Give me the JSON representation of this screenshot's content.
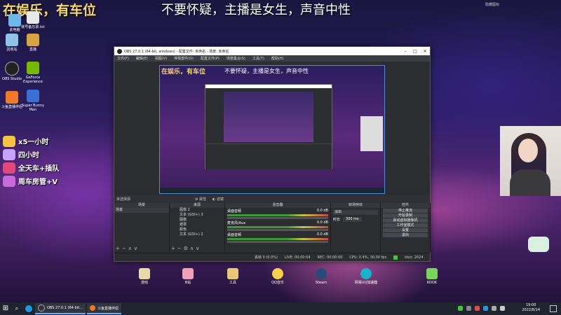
{
  "overlay": {
    "title_left": "在娱乐，有车位",
    "title_center": "不要怀疑，主播是女生，声音中性",
    "top_right_label": "隐藏图标"
  },
  "desktop_icons": [
    {
      "label": "此电脑",
      "color": "#6fb7e8"
    },
    {
      "label": "账号备忘录.txt",
      "color": "#e8e8e8"
    },
    {
      "label": "回收站",
      "color": "#8fc3e8"
    },
    {
      "label": "直播",
      "color": "#d9a441"
    },
    {
      "label": "OBS Studio",
      "color": "#222222"
    },
    {
      "label": "GeForce Experience",
      "color": "#76b900"
    },
    {
      "label": "斗鱼直播伴侣",
      "color": "#f07a2a"
    },
    {
      "label": "Super Bunny Man",
      "color": "#3a6fd8"
    }
  ],
  "badges": [
    {
      "label": "x5一小时",
      "color": "#f5c542"
    },
    {
      "label": "四小时",
      "color": "#c7a3ff"
    },
    {
      "label": "全天车+插队",
      "color": "#e04a7a"
    },
    {
      "label": "周车房管+V",
      "color": "#c86ad8"
    }
  ],
  "obs": {
    "title": "OBS 27.0.1 (64-bit, windows) - 配置文件: 未命名 - 场景: 未命名",
    "menu": [
      "文件(F)",
      "编辑(E)",
      "视图(V)",
      "停靠部件(D)",
      "配置文件(P)",
      "场景集合(S)",
      "工具(T)",
      "帮助(H)"
    ],
    "preview_title_left": "在娱乐，有车位",
    "preview_title_center": "不要怀疑，主播是女生，声音中性",
    "ctrlbar_label": "未选择源",
    "ctrlbar_props": "属性",
    "ctrlbar_filters": "滤镜",
    "docks": {
      "scenes_header": "场景",
      "scenes_items": [
        "场景"
      ],
      "sources_header": "来源",
      "sources_items": [
        "图像 2",
        "文本 (GDI+) 3",
        "图像",
        "遮罩",
        "颜色",
        "文本 (GDI+) 2"
      ],
      "mixer_header": "混音器",
      "mixer_channels": [
        {
          "name": "桌面音频",
          "level": "0.0 dB"
        },
        {
          "name": "麦克风/Aux",
          "level": "0.0 dB"
        },
        {
          "name": "桌面音频",
          "level": "0.0 dB"
        }
      ],
      "transition_header": "转场特效",
      "transition_type": "淡出",
      "transition_duration_label": "时长",
      "transition_duration": "300 ms",
      "controls_header": "控件",
      "controls_buttons": [
        "停止推流",
        "开始录制",
        "启动虚拟摄像机",
        "工作室模式",
        "设置",
        "退出"
      ]
    },
    "status": {
      "dropped": "丢帧 0 (0.0%)",
      "live": "LIVE: 00:00:04",
      "rec": "REC: 00:00:00",
      "cpu": "CPU: 0.4%, 30.00 fps",
      "bitrate": "kb/s: 2024"
    }
  },
  "bottom_dock": [
    {
      "label": "游戏",
      "color": "#e8d9a8"
    },
    {
      "label": "B站",
      "color": "#f0a0b8"
    },
    {
      "label": "工具",
      "color": "#e8c878"
    },
    {
      "label": "QQ音乐",
      "color": "#f5d04a"
    },
    {
      "label": "Steam",
      "color": "#2a4a7a"
    },
    {
      "label": "网易UU加速器",
      "color": "#1ab0c8"
    },
    {
      "label": "KOOK",
      "color": "#7ad45a"
    }
  ],
  "taskbar": {
    "tasks": [
      {
        "label": "OBS 27.0.1 (64-bit...",
        "color": "#333333"
      },
      {
        "label": "斗鱼直播伴侣",
        "color": "#f07a2a"
      }
    ],
    "clock_time": "19:00",
    "clock_date": "2022/8/14"
  }
}
